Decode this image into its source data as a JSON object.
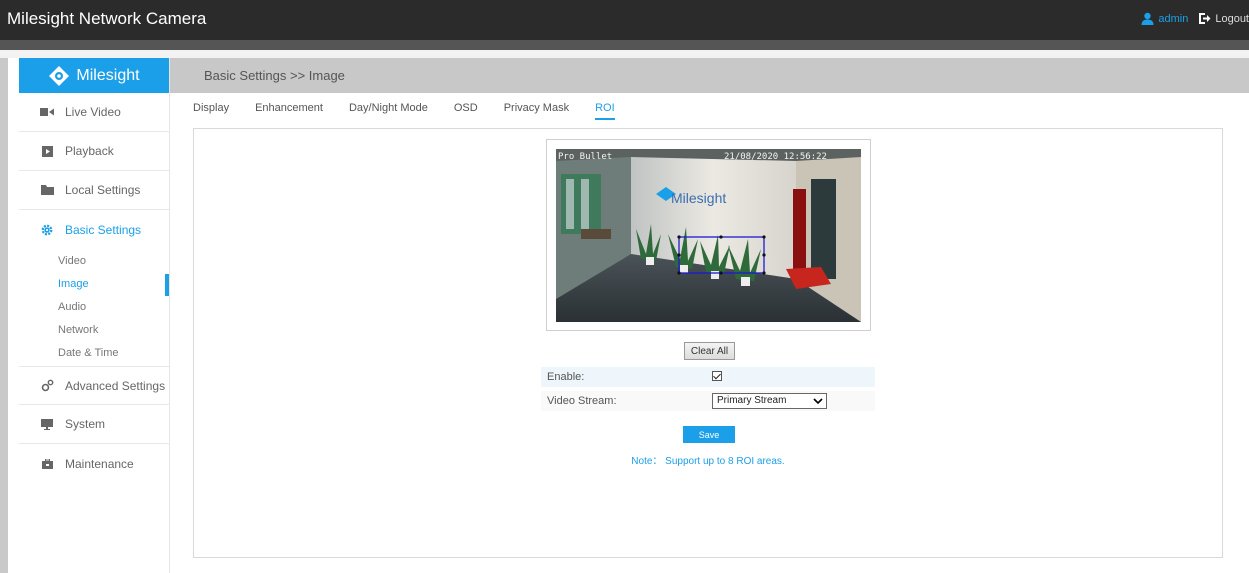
{
  "app": {
    "title": "Milesight Network Camera",
    "user": "admin",
    "logout": "Logout",
    "brand": "Milesight",
    "accent_color": "#1b9fe8"
  },
  "sidebar": {
    "items": [
      {
        "label": "Live Video",
        "icon": "video-camera-icon"
      },
      {
        "label": "Playback",
        "icon": "playback-icon"
      },
      {
        "label": "Local Settings",
        "icon": "folder-icon"
      },
      {
        "label": "Basic Settings",
        "icon": "gear-icon",
        "active": true
      },
      {
        "label": "Advanced Settings",
        "icon": "gears-icon"
      },
      {
        "label": "System",
        "icon": "monitor-icon"
      },
      {
        "label": "Maintenance",
        "icon": "toolbox-icon"
      }
    ],
    "subitems": [
      {
        "label": "Video"
      },
      {
        "label": "Image",
        "active": true
      },
      {
        "label": "Audio"
      },
      {
        "label": "Network"
      },
      {
        "label": "Date & Time"
      }
    ]
  },
  "header": {
    "breadcrumb": "Basic Settings >> Image"
  },
  "tabs": [
    {
      "label": "Display"
    },
    {
      "label": "Enhancement"
    },
    {
      "label": "Day/Night Mode"
    },
    {
      "label": "OSD"
    },
    {
      "label": "Privacy Mask"
    },
    {
      "label": "ROI",
      "active": true
    }
  ],
  "preview": {
    "osd_left": "Pro Bullet",
    "osd_right": "21/08/2020 12:56:22",
    "wall_logo": "Milesight"
  },
  "roi": {
    "clear_label": "Clear All",
    "enable_label": "Enable:",
    "enable_checked": true,
    "stream_label": "Video Stream:",
    "stream_value": "Primary Stream",
    "save_label": "Save",
    "note": "Note： Support up to 8 ROI areas."
  }
}
